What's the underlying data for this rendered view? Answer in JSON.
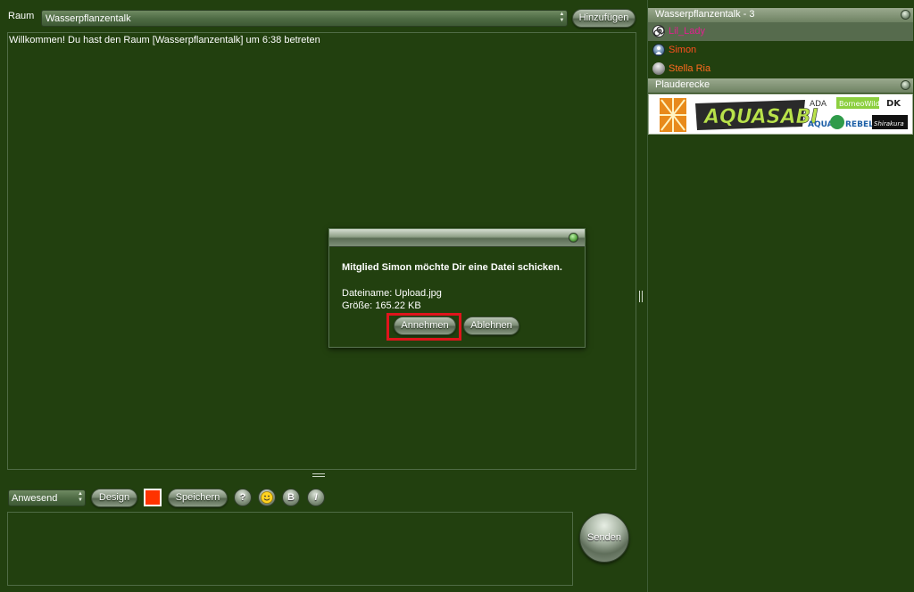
{
  "top_bar": {
    "room_label": "Raum",
    "room_value": "Wasserpflanzentalk",
    "add_button": "Hinzufügen"
  },
  "chat": {
    "welcome_message": "Willkommen! Du hast den Raum [Wasserpflanzentalk] um 6:38 betreten"
  },
  "right_panel": {
    "room_header": "Wasserpflanzentalk - 3",
    "users": [
      {
        "name": "Lil_Lady",
        "color": "#e0208f",
        "icon": "spiral-icon",
        "selected": true
      },
      {
        "name": "Simon",
        "color": "#ff4f1f",
        "icon": "male-avatar-icon",
        "selected": false
      },
      {
        "name": "Stella Ria",
        "color": "#ff6a1f",
        "icon": "grey-ball-icon",
        "selected": false
      }
    ],
    "second_header": "Plauderecke",
    "banner": {
      "logo_text": "AQUASABI",
      "brands": [
        "ADA",
        "BorneoWild",
        "DK",
        "AQUA",
        "REBELL",
        "Shirakura"
      ]
    }
  },
  "toolbar": {
    "status_value": "Anwesend",
    "design_button": "Design",
    "color_swatch": "#ff3300",
    "save_button": "Speichern",
    "help_button": "?",
    "smiley_button": "smiley-icon",
    "bold_button": "B",
    "italic_button": "I",
    "send_button": "Senden"
  },
  "dialog": {
    "message": "Mitglied Simon möchte Dir eine Datei schicken.",
    "filename_line": "Dateiname: Upload.jpg",
    "size_line": "Größe: 165.22 KB",
    "accept_button": "Annehmen",
    "decline_button": "Ablehnen"
  },
  "colors": {
    "background": "#22400f",
    "highlight": "#e0141c"
  }
}
